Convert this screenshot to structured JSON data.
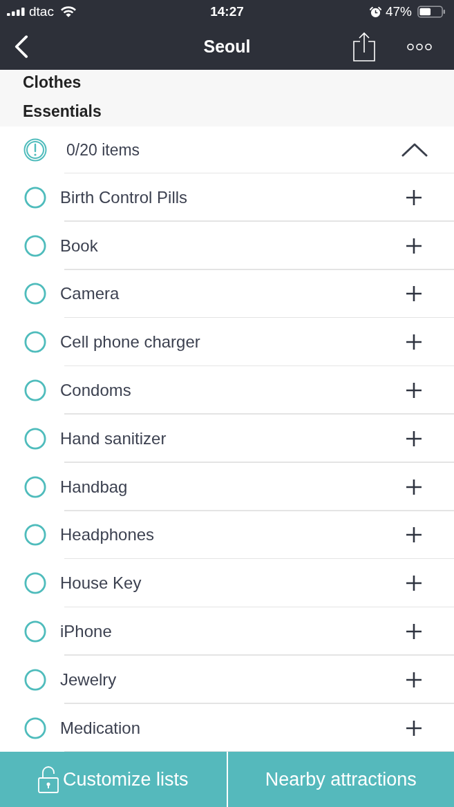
{
  "status_bar": {
    "carrier": "dtac",
    "time": "14:27",
    "battery": "47%"
  },
  "nav_bar": {
    "title": "Seoul"
  },
  "sections": [
    {
      "title": "Clothes"
    },
    {
      "title": "Essentials"
    }
  ],
  "summary": {
    "count": "0/20 items",
    "expanded": true
  },
  "items": [
    {
      "label": "Birth Control Pills",
      "checked": false
    },
    {
      "label": "Book",
      "checked": false
    },
    {
      "label": "Camera",
      "checked": false
    },
    {
      "label": "Cell phone charger",
      "checked": false
    },
    {
      "label": "Condoms",
      "checked": false
    },
    {
      "label": "Hand sanitizer",
      "checked": false
    },
    {
      "label": "Handbag",
      "checked": false
    },
    {
      "label": "Headphones",
      "checked": false
    },
    {
      "label": "House Key",
      "checked": false
    },
    {
      "label": "iPhone",
      "checked": false
    },
    {
      "label": "Jewelry",
      "checked": false
    },
    {
      "label": "Medication",
      "checked": false
    }
  ],
  "bottom_bar": {
    "buttons": [
      {
        "label": "Customize lists",
        "kind": "unlock"
      },
      {
        "label": "Nearby attractions",
        "kind": "plain"
      }
    ]
  }
}
